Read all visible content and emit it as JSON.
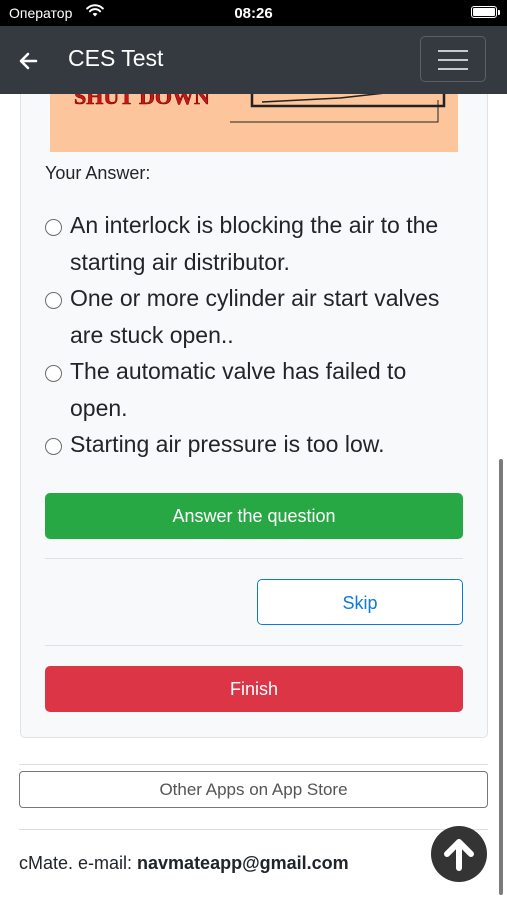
{
  "status_bar": {
    "carrier": "Оператор",
    "time": "08:26"
  },
  "navbar": {
    "title": "CES Test",
    "back_icon": "arrow-left-icon",
    "menu_icon": "hamburger-menu-icon"
  },
  "question_image": {
    "visible_text": "SHUT DOWN"
  },
  "answer": {
    "label": "Your Answer:",
    "options": [
      {
        "text": "An interlock is blocking the air to the starting air distributor.",
        "selected": false
      },
      {
        "text": "One or more cylinder air start valves are stuck open..",
        "selected": false
      },
      {
        "text": "The automatic valve has failed to open.",
        "selected": false
      },
      {
        "text": "Starting air pressure is too low.",
        "selected": false
      }
    ]
  },
  "buttons": {
    "answer_label": "Answer the question",
    "skip_label": "Skip",
    "finish_label": "Finish"
  },
  "footer": {
    "other_apps_label": "Other Apps on App Store",
    "contact_prefix": "cMate. e-mail: ",
    "contact_email": "navmateapp@gmail.com"
  },
  "colors": {
    "navbar": "#343a40",
    "answer_button": "#28a745",
    "skip_button": "#0d7bdc",
    "finish_button": "#dc3545",
    "image_background": "#fcc59b"
  }
}
